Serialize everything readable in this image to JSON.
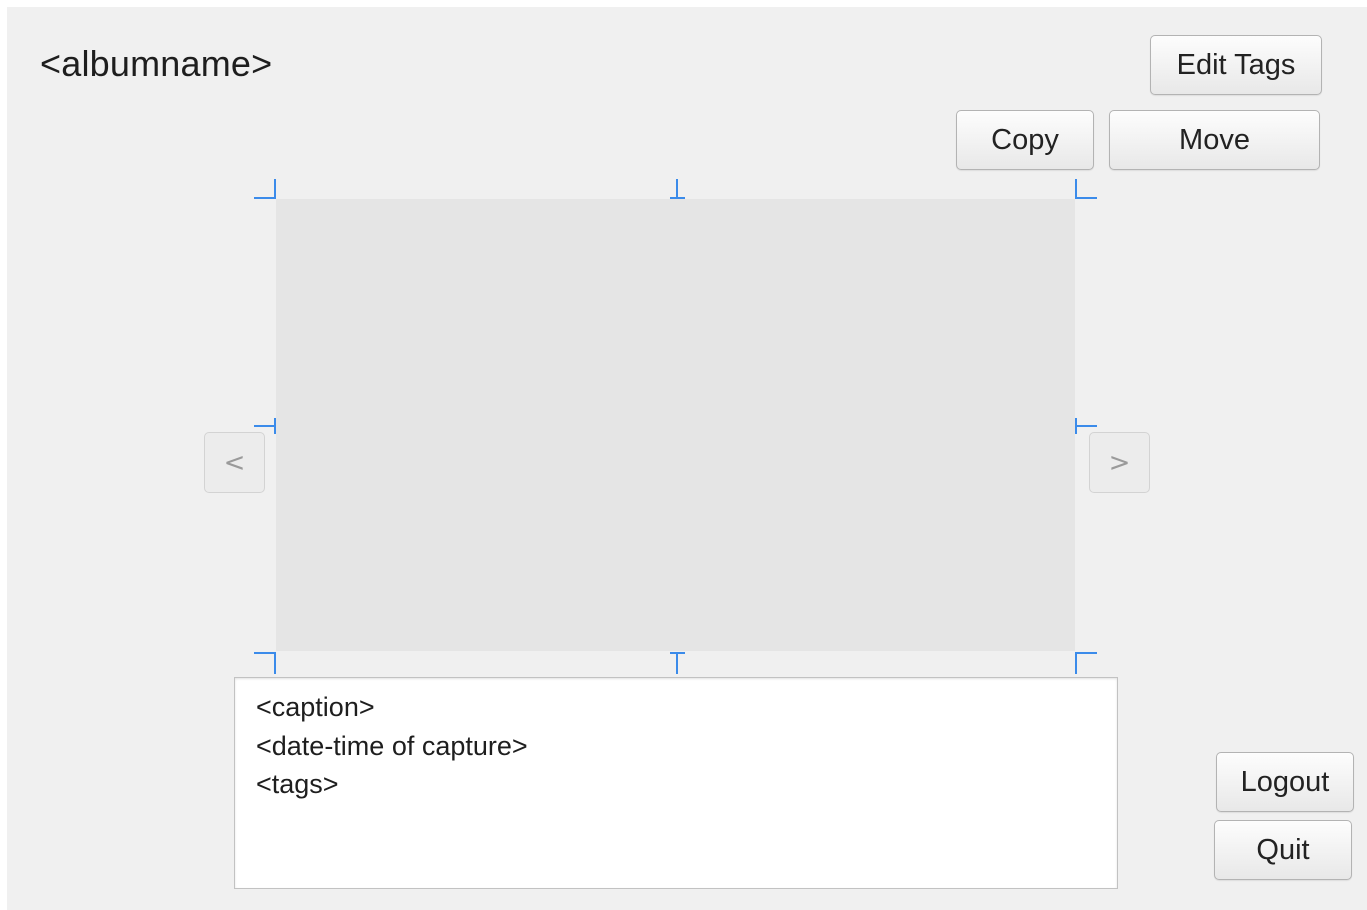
{
  "album": {
    "name": "<albumname>"
  },
  "toolbar": {
    "edit_tags_label": "Edit Tags",
    "copy_label": "Copy",
    "move_label": "Move"
  },
  "navigation": {
    "prev_label": "<",
    "next_label": ">"
  },
  "photo_info": {
    "caption": "<caption>",
    "datetime": "<date-time of capture>",
    "tags": "<tags>"
  },
  "session": {
    "logout_label": "Logout",
    "quit_label": "Quit"
  },
  "colors": {
    "window_bg": "#f0f0f0",
    "image_placeholder": "#e5e5e5",
    "selection_handle": "#3b8bea"
  },
  "icons": {
    "prev": "chevron-left-icon",
    "next": "chevron-right-icon"
  }
}
